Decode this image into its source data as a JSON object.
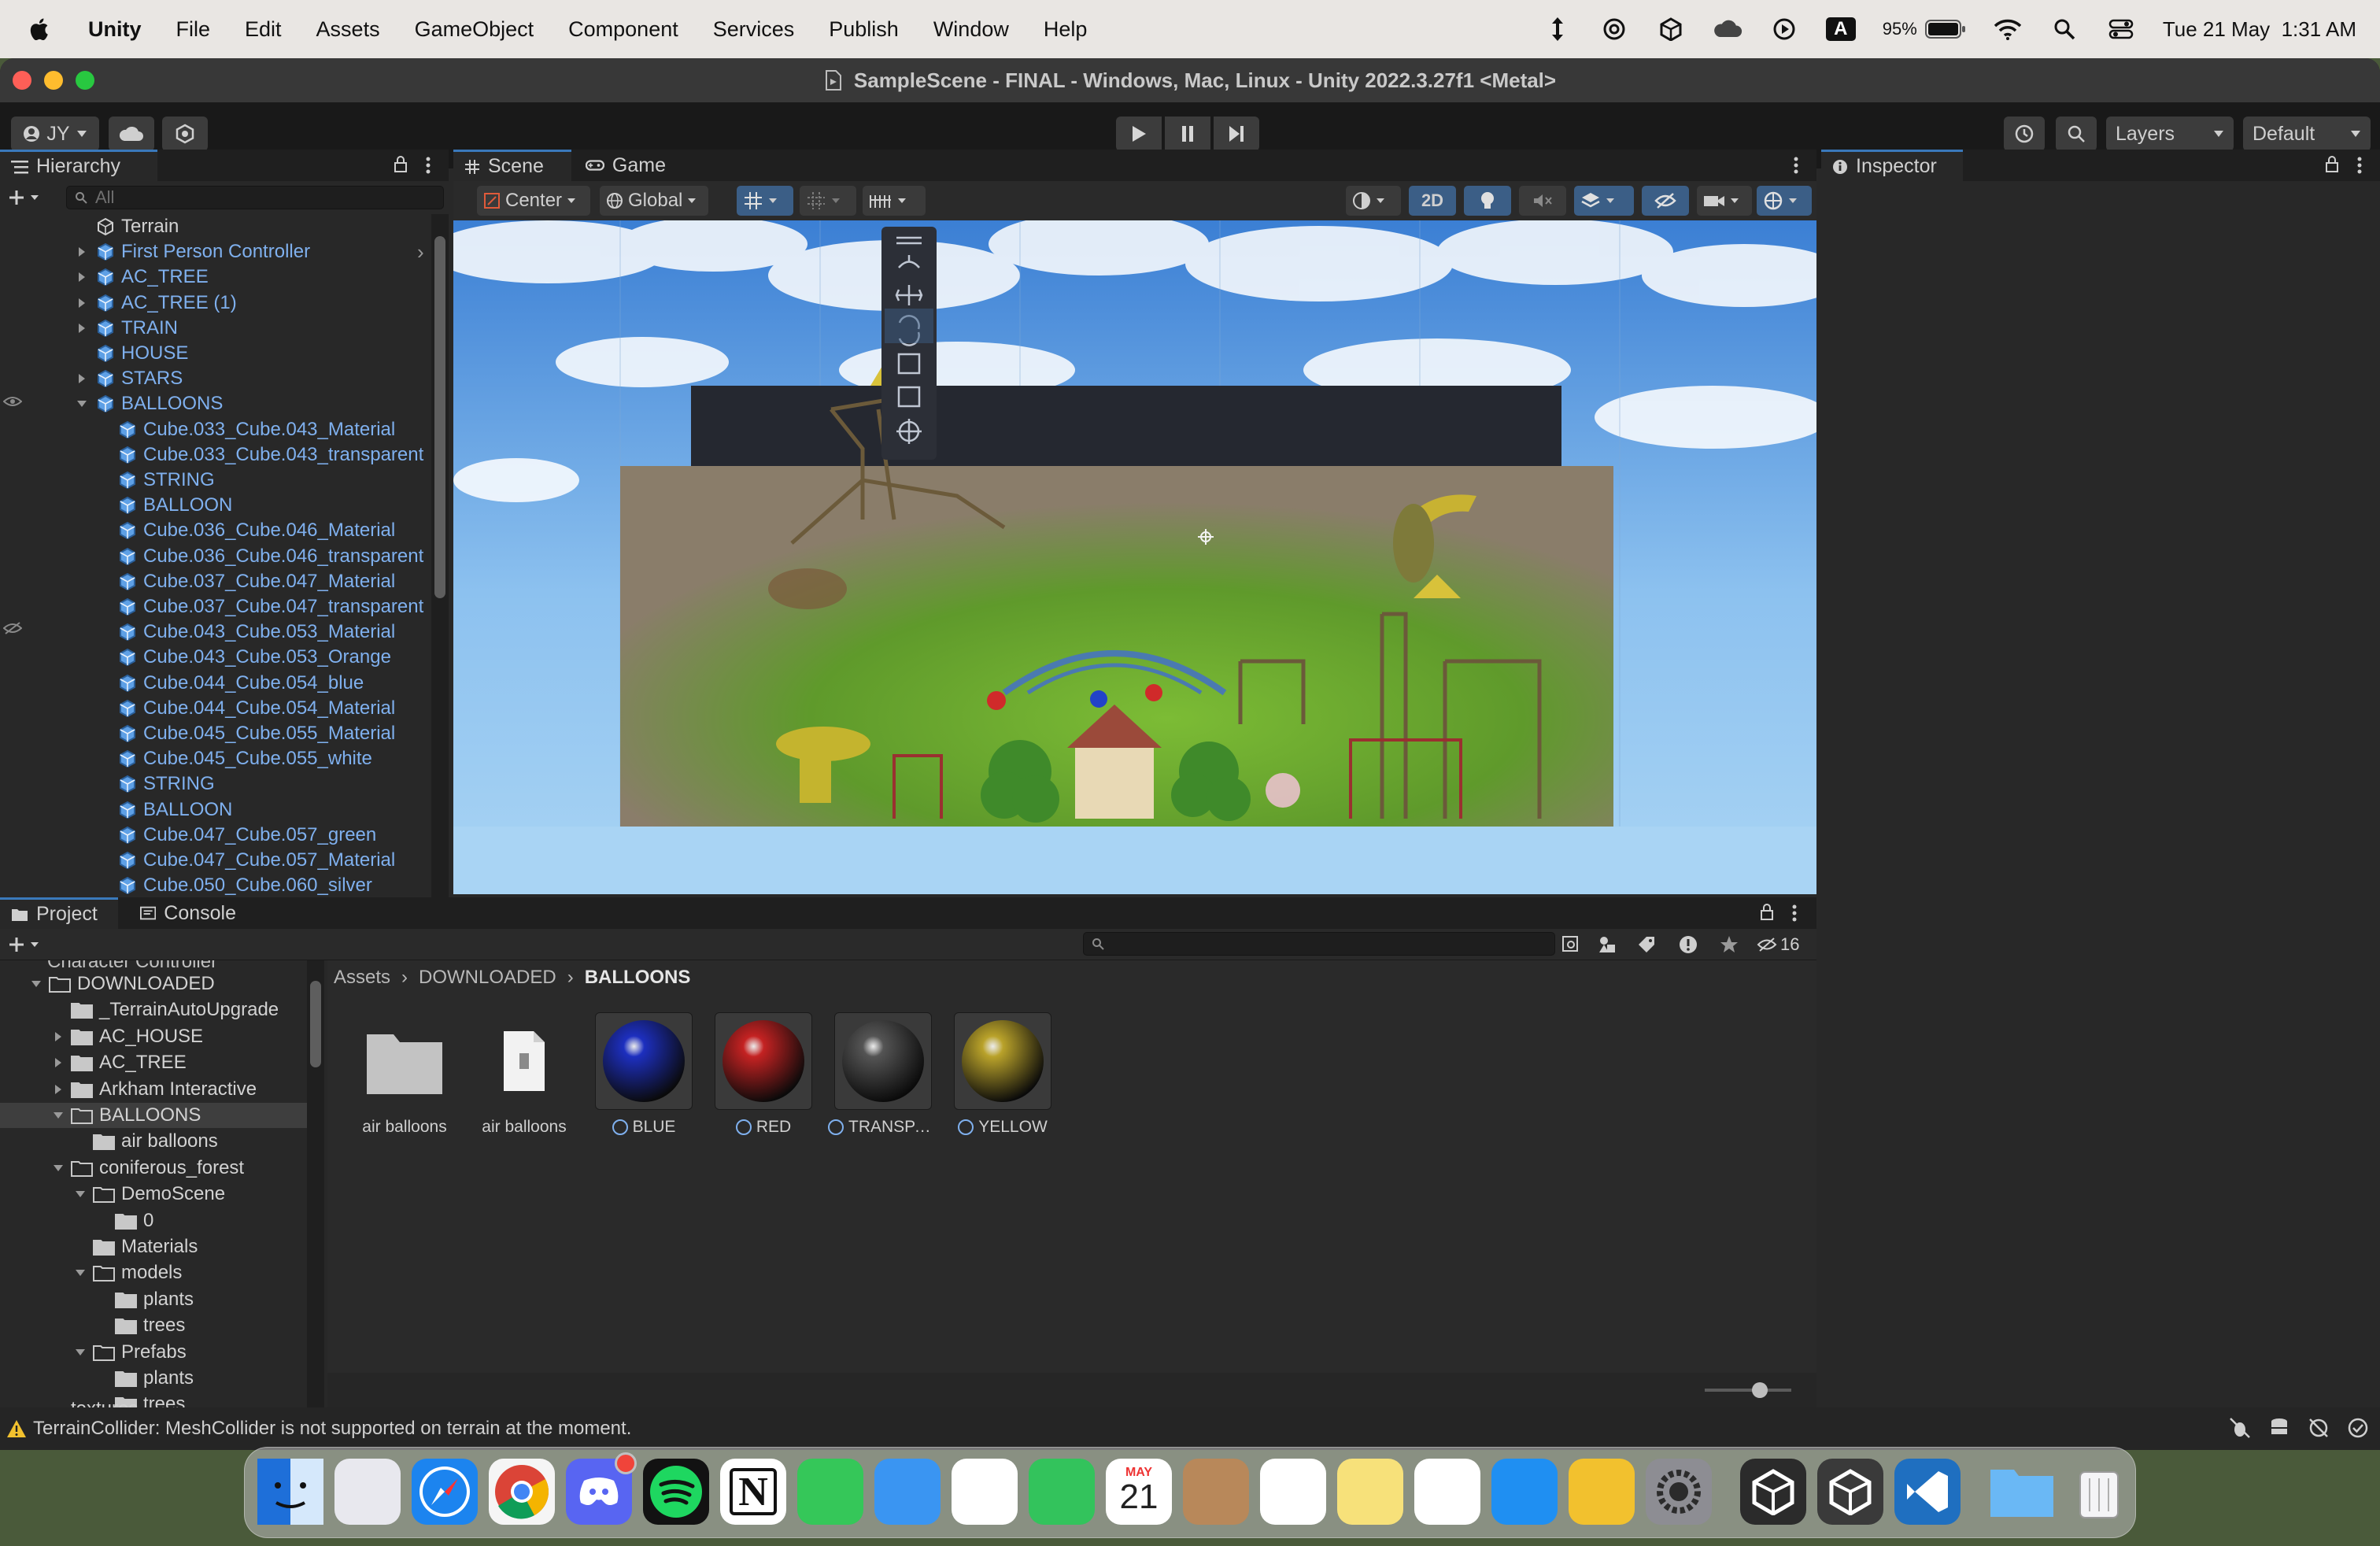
{
  "menubar": {
    "app_name": "Unity",
    "items": [
      "File",
      "Edit",
      "Assets",
      "GameObject",
      "Component",
      "Services",
      "Publish",
      "Window",
      "Help"
    ],
    "battery": "95%",
    "input_badge": "A",
    "datetime": "Tue 21 May  1:31 AM"
  },
  "window": {
    "title": "SampleScene - FINAL - Windows, Mac, Linux - Unity 2022.3.27f1 <Metal>"
  },
  "toolbar": {
    "account": "JY",
    "layers_label": "Layers",
    "layout_label": "Default"
  },
  "hierarchy": {
    "tab_label": "Hierarchy",
    "search_placeholder": "All",
    "items": [
      {
        "label": "Terrain",
        "indent": 0,
        "expandable": false,
        "prefab": false
      },
      {
        "label": "First Person Controller",
        "indent": 0,
        "expandable": true,
        "prefab": true,
        "has_child_arrow": true
      },
      {
        "label": "AC_TREE",
        "indent": 0,
        "expandable": true,
        "prefab": true
      },
      {
        "label": "AC_TREE (1)",
        "indent": 0,
        "expandable": true,
        "prefab": true
      },
      {
        "label": "TRAIN",
        "indent": 0,
        "expandable": true,
        "prefab": true
      },
      {
        "label": "HOUSE",
        "indent": 0,
        "expandable": false,
        "prefab": true
      },
      {
        "label": "STARS",
        "indent": 0,
        "expandable": true,
        "prefab": true
      },
      {
        "label": "BALLOONS",
        "indent": 0,
        "expandable": true,
        "expanded": true,
        "prefab": true
      },
      {
        "label": "Cube.033_Cube.043_Material",
        "indent": 1,
        "prefab": true
      },
      {
        "label": "Cube.033_Cube.043_transparent",
        "indent": 1,
        "prefab": true
      },
      {
        "label": "STRING",
        "indent": 1,
        "prefab": true
      },
      {
        "label": "BALLOON",
        "indent": 1,
        "prefab": true
      },
      {
        "label": "Cube.036_Cube.046_Material",
        "indent": 1,
        "prefab": true
      },
      {
        "label": "Cube.036_Cube.046_transparent",
        "indent": 1,
        "prefab": true
      },
      {
        "label": "Cube.037_Cube.047_Material",
        "indent": 1,
        "prefab": true
      },
      {
        "label": "Cube.037_Cube.047_transparent",
        "indent": 1,
        "prefab": true
      },
      {
        "label": "Cube.043_Cube.053_Material",
        "indent": 1,
        "prefab": true
      },
      {
        "label": "Cube.043_Cube.053_Orange",
        "indent": 1,
        "prefab": true
      },
      {
        "label": "Cube.044_Cube.054_blue",
        "indent": 1,
        "prefab": true
      },
      {
        "label": "Cube.044_Cube.054_Material",
        "indent": 1,
        "prefab": true
      },
      {
        "label": "Cube.045_Cube.055_Material",
        "indent": 1,
        "prefab": true
      },
      {
        "label": "Cube.045_Cube.055_white",
        "indent": 1,
        "prefab": true
      },
      {
        "label": "STRING",
        "indent": 1,
        "prefab": true
      },
      {
        "label": "BALLOON",
        "indent": 1,
        "prefab": true
      },
      {
        "label": "Cube.047_Cube.057_green",
        "indent": 1,
        "prefab": true
      },
      {
        "label": "Cube.047_Cube.057_Material",
        "indent": 1,
        "prefab": true
      },
      {
        "label": "Cube.050_Cube.060_silver",
        "indent": 1,
        "prefab": true
      }
    ]
  },
  "scene_view": {
    "tabs": [
      "Scene",
      "Game"
    ],
    "active_tab": "Scene",
    "pivot_label": "Center",
    "space_label": "Global",
    "mode_2d_label": "2D"
  },
  "inspector": {
    "tab_label": "Inspector"
  },
  "project": {
    "tabs": [
      "Project",
      "Console"
    ],
    "active_tab": "Project",
    "hidden_count": "16",
    "breadcrumb": [
      "Assets",
      "DOWNLOADED",
      "BALLOONS"
    ],
    "tree_cut_top": "Character Controller",
    "tree": [
      {
        "label": "DOWNLOADED",
        "indent": 0,
        "arrow": "down"
      },
      {
        "label": "_TerrainAutoUpgrade",
        "indent": 1,
        "arrow": "none"
      },
      {
        "label": "AC_HOUSE",
        "indent": 1,
        "arrow": "right"
      },
      {
        "label": "AC_TREE",
        "indent": 1,
        "arrow": "right"
      },
      {
        "label": "Arkham Interactive",
        "indent": 1,
        "arrow": "right"
      },
      {
        "label": "BALLOONS",
        "indent": 1,
        "arrow": "down",
        "selected": true
      },
      {
        "label": "air balloons",
        "indent": 2,
        "arrow": "none"
      },
      {
        "label": "coniferous_forest",
        "indent": 1,
        "arrow": "down"
      },
      {
        "label": "DemoScene",
        "indent": 2,
        "arrow": "down"
      },
      {
        "label": "0",
        "indent": 3,
        "arrow": "none"
      },
      {
        "label": "Materials",
        "indent": 2,
        "arrow": "none"
      },
      {
        "label": "models",
        "indent": 2,
        "arrow": "down"
      },
      {
        "label": "plants",
        "indent": 3,
        "arrow": "none"
      },
      {
        "label": "trees",
        "indent": 3,
        "arrow": "none"
      },
      {
        "label": "Prefabs",
        "indent": 2,
        "arrow": "down"
      },
      {
        "label": "plants",
        "indent": 3,
        "arrow": "none"
      },
      {
        "label": "trees",
        "indent": 3,
        "arrow": "none"
      }
    ],
    "tree_cut_bottom": "textures",
    "assets": [
      {
        "label": "air balloons",
        "kind": "folder"
      },
      {
        "label": "air balloons",
        "kind": "file"
      },
      {
        "label": "BLUE",
        "kind": "material",
        "color": "#1d2fbf"
      },
      {
        "label": "RED",
        "kind": "material",
        "color": "#c42222"
      },
      {
        "label": "TRANSPAR...",
        "kind": "material",
        "color": "#545454"
      },
      {
        "label": "YELLOW",
        "kind": "material",
        "color": "#b9a22a"
      }
    ]
  },
  "status": {
    "message": "TerrainCollider: MeshCollider is not supported on terrain at the moment."
  },
  "dock": {
    "calendar_month": "MAY",
    "calendar_day": "21",
    "apps": [
      "finder-icon",
      "launchpad-icon",
      "safari-icon",
      "chrome-icon",
      "discord-icon",
      "spotify-icon",
      "notion-icon",
      "messages-icon",
      "mail-icon",
      "photos-icon",
      "facetime-icon",
      "calendar-icon",
      "contacts-icon",
      "reminders-icon",
      "notes-icon",
      "freeform-icon",
      "app-store-icon",
      "keynote-icon",
      "system-settings-icon",
      "unity-hub-icon",
      "unity-icon",
      "vscode-icon",
      "downloads-folder-icon",
      "trash-icon"
    ]
  },
  "colors": {
    "accent": "#3a79bb",
    "prefab_text": "#7fb0ee",
    "sky": "#9dcaf0",
    "warning": "#f2c12e"
  }
}
